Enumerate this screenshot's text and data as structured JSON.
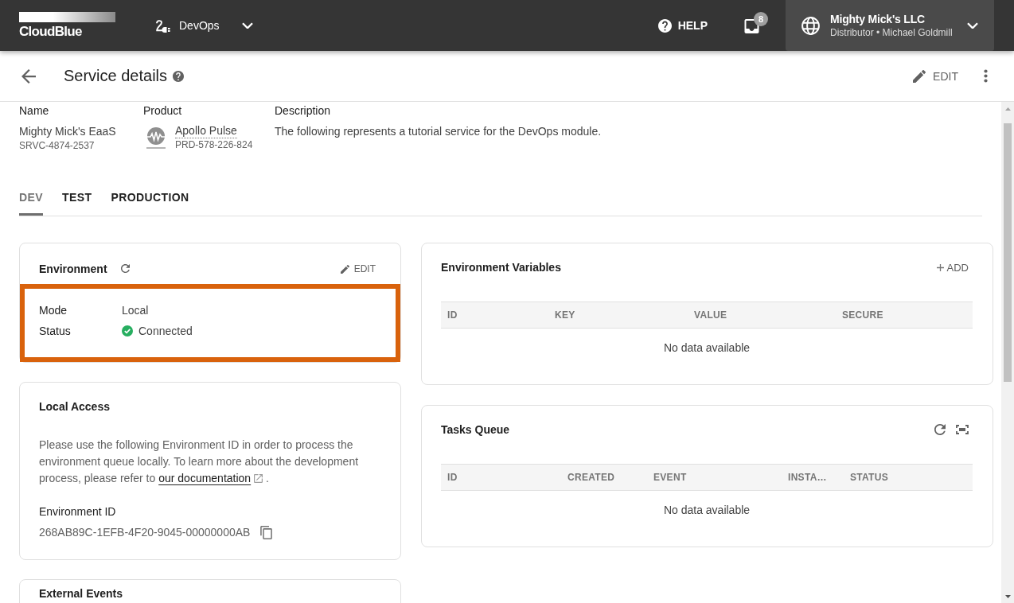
{
  "header": {
    "logo": "CloudBlue",
    "module": "DevOps",
    "help": "HELP",
    "notifications": "8",
    "account": {
      "name": "Mighty Mick's LLC",
      "subtitle": "Distributor • Michael Goldmill"
    }
  },
  "page_header": {
    "title": "Service details",
    "edit": "EDIT"
  },
  "service": {
    "fields": [
      {
        "kind": "name",
        "label": "Name",
        "value": "Mighty Mick's EaaS",
        "id": "SRVC-4874-2537"
      },
      {
        "kind": "product",
        "label": "Product",
        "value": "Apollo Pulse",
        "id": "PRD-578-226-824"
      },
      {
        "kind": "description",
        "label": "Description",
        "value": "The following represents a tutorial service for the DevOps module."
      }
    ]
  },
  "tabs": [
    {
      "label": "DEV",
      "selected": true
    },
    {
      "label": "TEST",
      "selected": false
    },
    {
      "label": "PRODUCTION",
      "selected": false
    }
  ],
  "environment": {
    "title": "Environment",
    "edit": "EDIT",
    "highlighted": true,
    "rows": [
      {
        "kind": "text",
        "label": "Mode",
        "value": "Local"
      },
      {
        "kind": "status",
        "label": "Status",
        "value": "Connected"
      }
    ]
  },
  "local_access": {
    "title": "Local Access",
    "text": "Please use the following Environment ID in order to process the environment queue locally. To learn more about the development process, please refer to ",
    "link": "our documentation",
    "text_end": ".",
    "id_label": "Environment ID",
    "id_value": "268AB89C-1EFB-4F20-9045-00000000AB"
  },
  "external_events": {
    "title": "External Events"
  },
  "tables": [
    {
      "title": "Environment Variables",
      "actions": [
        {
          "kind": "add",
          "label": "ADD"
        }
      ],
      "columns": [
        "ID",
        "KEY",
        "VALUE",
        "SECURE"
      ],
      "empty": "No data available"
    },
    {
      "title": "Tasks Queue",
      "actions": [
        {
          "kind": "refresh"
        },
        {
          "kind": "expand"
        }
      ],
      "columns": [
        "ID",
        "CREATED",
        "EVENT",
        "INSTA…",
        "STATUS"
      ],
      "empty": "No data available"
    }
  ]
}
